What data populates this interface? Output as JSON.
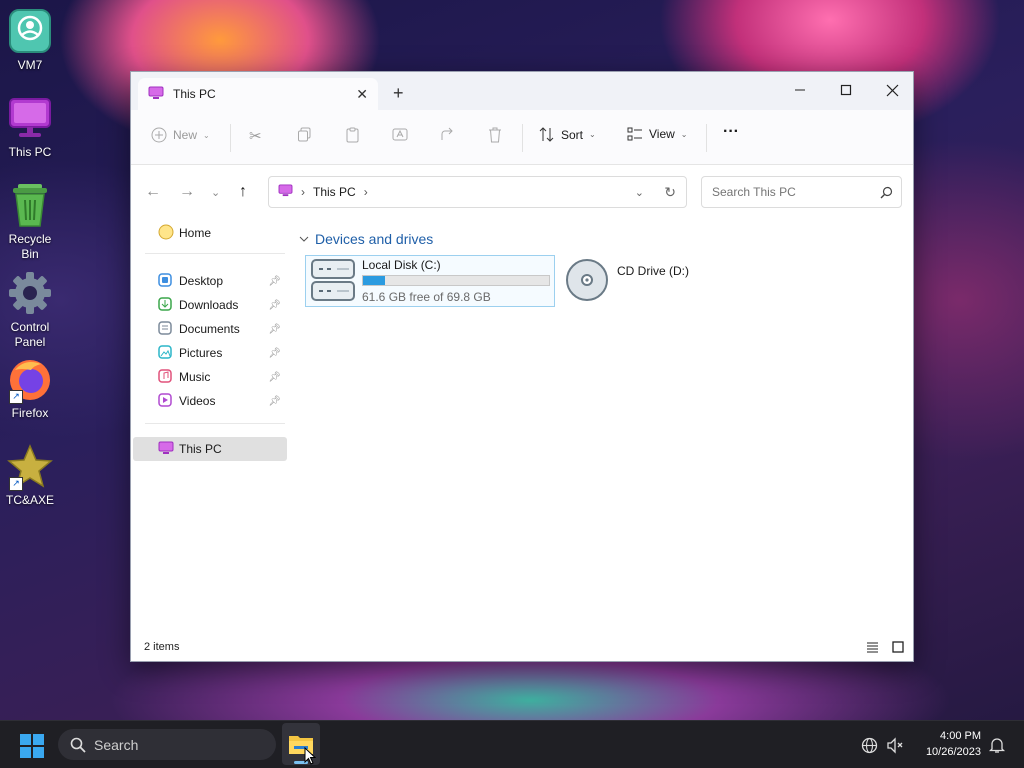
{
  "desktop": {
    "icons": [
      {
        "label": "VM7",
        "icon": "user-app-icon"
      },
      {
        "label": "This PC",
        "icon": "monitor-icon"
      },
      {
        "label": "Recycle Bin",
        "icon": "recycle-bin-icon"
      },
      {
        "label": "Control Panel",
        "icon": "gear-icon"
      },
      {
        "label": "Firefox",
        "icon": "firefox-icon"
      },
      {
        "label": "TC&AXE",
        "icon": "star-icon"
      }
    ]
  },
  "window": {
    "tab_title": "This PC",
    "toolbar": {
      "new_label": "New",
      "sort_label": "Sort",
      "view_label": "View",
      "more_label": "···"
    },
    "address": {
      "path": "This PC",
      "separator": "›"
    },
    "search": {
      "placeholder": "Search This PC"
    },
    "sidebar": {
      "home": "Home",
      "quick": [
        {
          "label": "Desktop",
          "color": "#3d8ee0"
        },
        {
          "label": "Downloads",
          "color": "#3aa64a"
        },
        {
          "label": "Documents",
          "color": "#7c8a9a"
        },
        {
          "label": "Pictures",
          "color": "#2bb6c8"
        },
        {
          "label": "Music",
          "color": "#e0507a"
        },
        {
          "label": "Videos",
          "color": "#b04ad0"
        }
      ],
      "this_pc": "This PC"
    },
    "content": {
      "group_title": "Devices and drives",
      "drives": [
        {
          "name": "Local Disk (C:)",
          "free_text": "61.6 GB free of 69.8 GB",
          "used_fraction": 0.117
        },
        {
          "name": "CD Drive (D:)"
        }
      ]
    },
    "status": {
      "items_text": "2 items"
    }
  },
  "taskbar": {
    "search_label": "Search",
    "time": "4:00 PM",
    "date": "10/26/2023"
  },
  "colors": {
    "accent": "#2b9be0",
    "group_title": "#1f5fa8",
    "this_pc_icon": "#c040d0"
  }
}
